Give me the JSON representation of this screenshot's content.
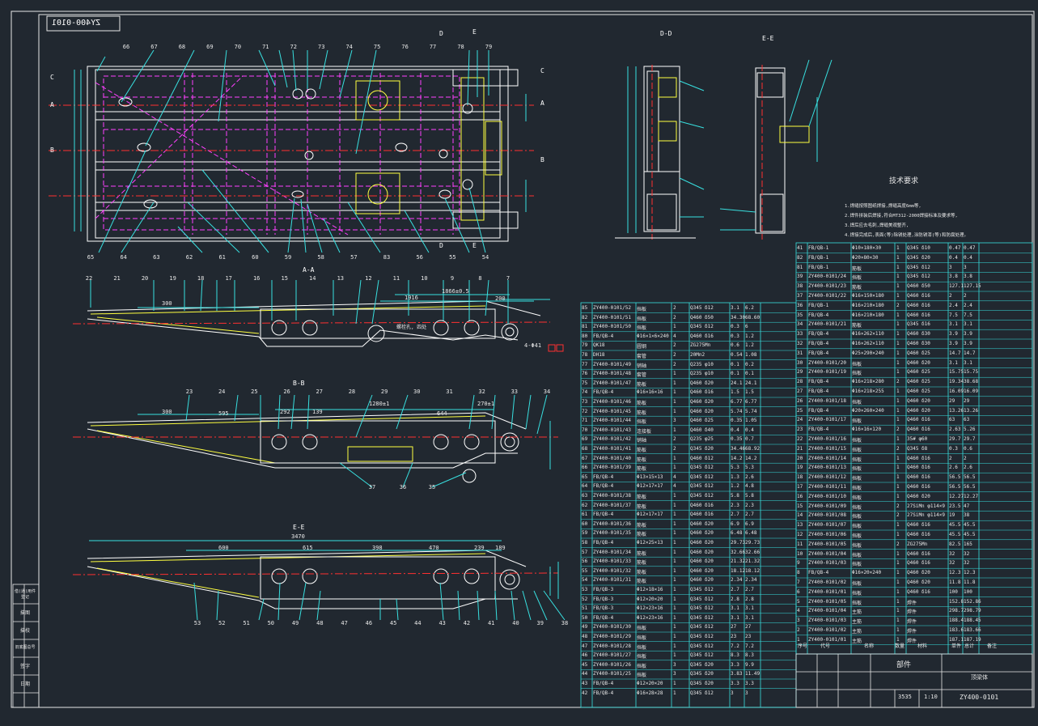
{
  "drawing": {
    "number_mirrored": "ZY400-0101",
    "title_block": {
      "part_type": "部件",
      "name": "顶梁体",
      "drawing_no": "ZY400-0101",
      "weight": "3535",
      "scale": "1:10"
    }
  },
  "views": {
    "aa": "A-A",
    "bb": "B-B",
    "ee_front": "E-E",
    "dd": "D-D",
    "ee": "E-E"
  },
  "section_markers": [
    "A",
    "B",
    "C",
    "D",
    "E"
  ],
  "plan_view": {
    "top_balloons": [
      "66",
      "67",
      "68",
      "69",
      "70",
      "71",
      "72",
      "73",
      "74",
      "75",
      "76",
      "77",
      "78",
      "79"
    ],
    "bottom_balloons": [
      "65",
      "64",
      "63",
      "62",
      "61",
      "60",
      "59",
      "58",
      "57",
      "83",
      "56",
      "55",
      "54"
    ]
  },
  "side_view_1": {
    "balloons": [
      "22",
      "21",
      "20",
      "19",
      "18",
      "17",
      "16",
      "15",
      "14",
      "13",
      "12",
      "11",
      "10",
      "9",
      "8",
      "7"
    ],
    "dims": [
      "300",
      "1916",
      "1866±0.5",
      "4-Φ41",
      "200",
      "4-Φ51"
    ],
    "note": "螺栓孔, 四处"
  },
  "side_view_2": {
    "balloons": [
      "23",
      "24",
      "25",
      "26",
      "27",
      "28",
      "29",
      "30",
      "31",
      "32",
      "33",
      "34",
      "37",
      "36",
      "35"
    ],
    "dims": [
      "300",
      "595",
      "292",
      "139",
      "1280±1",
      "644",
      "270±1",
      "240",
      "2×59",
      "R",
      "R"
    ]
  },
  "side_view_3": {
    "balloons": [
      "53",
      "52",
      "51",
      "50",
      "49",
      "48",
      "47",
      "46",
      "45",
      "44",
      "43",
      "42",
      "41",
      "40",
      "39",
      "38"
    ],
    "dims": [
      "3470",
      "600",
      "615",
      "398",
      "470",
      "239",
      "189"
    ]
  },
  "tech_requirements": {
    "title": "技术要求",
    "lines": [
      "1.焊缝按照图纸焊接,焊缝高度6mm等,",
      "2.焊件拼装后焊接,符合MT312-2000焊接标准及要求等,",
      "3.焊后应去毛刺,焊缝美观整齐,",
      "4.焊接完成后,表面(等)除锈处理,涂防锈漆(等)和防腐处理。"
    ]
  },
  "bom_left": [
    [
      "85",
      "ZY400-0101/52",
      "挡板",
      "2",
      "Q345 δ12",
      "3.1",
      "6.2"
    ],
    [
      "82",
      "ZY400-0101/51",
      "挡板",
      "2",
      "Q460 δ50",
      "34.30",
      "68.60"
    ],
    [
      "81",
      "ZY400-0101/50",
      "挡板",
      "1",
      "Q345 δ12",
      "0.3",
      "6"
    ],
    [
      "80",
      "FB/QB-4",
      "Φ16×1×6×240",
      "4",
      "Q460 δ16",
      "0.3",
      "1.2"
    ],
    [
      "79",
      "QK18",
      "圆钢",
      "2",
      "ZG275Mn",
      "0.6",
      "1.2"
    ],
    [
      "78",
      "DH18",
      "套管",
      "2",
      "20Mn2",
      "0.54",
      "1.08"
    ],
    [
      "77",
      "ZY400-0101/49",
      "销轴",
      "2",
      "Q235 φ10",
      "0.1",
      "0.2"
    ],
    [
      "76",
      "ZY400-0101/48",
      "套管",
      "1",
      "Q235 φ10",
      "0.1",
      "0.1"
    ],
    [
      "75",
      "ZY400-0101/47",
      "筋板",
      "1",
      "Q460 δ20",
      "24.1",
      "24.1"
    ],
    [
      "74",
      "FB/QB-4",
      "Φ16×16×16",
      "1",
      "Q460 δ16",
      "1.5",
      "1.5"
    ],
    [
      "73",
      "ZY400-0101/46",
      "筋板",
      "1",
      "Q460 δ20",
      "6.77",
      "6.77"
    ],
    [
      "72",
      "ZY400-0101/45",
      "筋板",
      "1",
      "Q460 δ20",
      "5.74",
      "5.74"
    ],
    [
      "71",
      "ZY400-0101/44",
      "挡板",
      "3",
      "Q460 δ25",
      "0.35",
      "1.05"
    ],
    [
      "70",
      "ZY400-0101/43",
      "连接板",
      "1",
      "Q460 δ40",
      "0.4",
      "0.4"
    ],
    [
      "69",
      "ZY400-0101/42",
      "销轴",
      "2",
      "Q235 φ25",
      "0.35",
      "0.7"
    ],
    [
      "68",
      "ZY400-0101/41",
      "筋板",
      "2",
      "Q345 δ20",
      "34.46",
      "68.92"
    ],
    [
      "67",
      "ZY400-0101/40",
      "筋板",
      "1",
      "Q460 δ12",
      "14.2",
      "14.2"
    ],
    [
      "66",
      "ZY400-0101/39",
      "筋板",
      "1",
      "Q345 δ12",
      "5.3",
      "5.3"
    ],
    [
      "65",
      "FB/QB-4",
      "Φ13×15×13",
      "4",
      "Q345 δ12",
      "1.3",
      "2.6"
    ],
    [
      "64",
      "FB/QB-4",
      "Φ12×17×17",
      "4",
      "Q345 δ12",
      "1.2",
      "4.8"
    ],
    [
      "63",
      "ZY400-0101/38",
      "筋板",
      "1",
      "Q345 δ12",
      "5.8",
      "5.8"
    ],
    [
      "62",
      "ZY400-0101/37",
      "筋板",
      "1",
      "Q460 δ16",
      "2.3",
      "2.3"
    ],
    [
      "61",
      "FB/QB-4",
      "Φ12×17×17",
      "1",
      "Q460 δ16",
      "2.7",
      "2.7"
    ],
    [
      "60",
      "ZY400-0101/36",
      "筋板",
      "1",
      "Q460 δ20",
      "6.9",
      "6.9"
    ],
    [
      "59",
      "ZY400-0101/35",
      "筋板",
      "1",
      "Q460 δ20",
      "6.48",
      "6.48"
    ],
    [
      "58",
      "FB/QB-4",
      "Φ12×25×13",
      "1",
      "Q460 δ20",
      "29.73",
      "29.73"
    ],
    [
      "57",
      "ZY400-0101/34",
      "筋板",
      "1",
      "Q460 δ20",
      "32.66",
      "32.66"
    ],
    [
      "56",
      "ZY400-0101/33",
      "筋板",
      "1",
      "Q460 δ20",
      "21.32",
      "21.32"
    ],
    [
      "55",
      "ZY400-0101/32",
      "筋板",
      "1",
      "Q460 δ20",
      "18.12",
      "18.12"
    ],
    [
      "54",
      "ZY400-0101/31",
      "筋板",
      "1",
      "Q460 δ20",
      "2.34",
      "2.34"
    ],
    [
      "53",
      "FB/QB-3",
      "Φ12×18×16",
      "1",
      "Q345 δ12",
      "2.7",
      "2.7"
    ],
    [
      "52",
      "FB/QB-3",
      "Φ12×20×20",
      "1",
      "Q345 δ12",
      "2.8",
      "2.8"
    ],
    [
      "51",
      "FB/QB-3",
      "Φ12×23×16",
      "1",
      "Q345 δ12",
      "3.1",
      "3.1"
    ],
    [
      "50",
      "FB/QB-4",
      "Φ12×23×16",
      "1",
      "Q345 δ12",
      "3.1",
      "3.1"
    ],
    [
      "49",
      "ZY400-0101/30",
      "挡板",
      "1",
      "Q345 δ12",
      "27",
      "27"
    ],
    [
      "48",
      "ZY400-0101/29",
      "挡板",
      "1",
      "Q345 δ12",
      "23",
      "23"
    ],
    [
      "47",
      "ZY400-0101/28",
      "挡板",
      "1",
      "Q345 δ12",
      "7.2",
      "7.2"
    ],
    [
      "46",
      "ZY400-0101/27",
      "挡板",
      "1",
      "Q345 δ12",
      "8.3",
      "8.3"
    ],
    [
      "45",
      "ZY400-0101/26",
      "挡板",
      "3",
      "Q345 δ20",
      "3.3",
      "9.9"
    ],
    [
      "44",
      "ZY400-0101/25",
      "挡板",
      "3",
      "Q345 δ20",
      "3.83",
      "11.49"
    ],
    [
      "43",
      "FB/QB-4",
      "Φ12×20×20",
      "1",
      "Q345 δ20",
      "3.3",
      "3.3"
    ],
    [
      "42",
      "FB/QB-4",
      "Φ16×28×28",
      "1",
      "Q345 δ12",
      "3",
      "3"
    ]
  ],
  "bom_right": [
    [
      "41",
      "FB/QB-1",
      "Φ10×180×30",
      "1",
      "Q345 δ10",
      "0.47",
      "0.47"
    ],
    [
      "82",
      "FB/QB-1",
      "Φ20×80×30",
      "1",
      "Q345 δ20",
      "0.4",
      "0.4"
    ],
    [
      "81",
      "FB/QB-1",
      "筋板",
      "1",
      "Q345 δ12",
      "3",
      "3"
    ],
    [
      "39",
      "ZY400-0101/24",
      "挡板",
      "1",
      "Q345 δ12",
      "3.8",
      "3.8"
    ],
    [
      "38",
      "ZY400-0101/23",
      "筋板",
      "1",
      "Q460 δ50",
      "127.15",
      "127.15"
    ],
    [
      "37",
      "ZY400-0101/22",
      "Φ16×150×180",
      "1",
      "Q460 δ16",
      "2",
      "2"
    ],
    [
      "36",
      "FB/QB-1",
      "Φ16×210×180",
      "2",
      "Q460 δ16",
      "2.4",
      "2.4"
    ],
    [
      "35",
      "FB/QB-4",
      "Φ16×210×180",
      "1",
      "Q460 δ16",
      "7.5",
      "7.5"
    ],
    [
      "34",
      "ZY400-0101/21",
      "筋板",
      "1",
      "Q345 δ16",
      "3.1",
      "3.1"
    ],
    [
      "33",
      "FB/QB-4",
      "Φ16×262×110",
      "1",
      "Q460 δ30",
      "3.9",
      "3.9"
    ],
    [
      "32",
      "FB/QB-4",
      "Φ16×262×110",
      "1",
      "Q460 δ30",
      "3.9",
      "3.9"
    ],
    [
      "31",
      "FB/QB-4",
      "Φ25×290×240",
      "1",
      "Q460 δ25",
      "14.7",
      "14.7"
    ],
    [
      "30",
      "ZY400-0101/20",
      "挡板",
      "1",
      "Q460 δ20",
      "3.1",
      "3.1"
    ],
    [
      "29",
      "ZY400-0101/19",
      "挡板",
      "1",
      "Q460 δ25",
      "15.75",
      "15.75"
    ],
    [
      "28",
      "FB/QB-4",
      "Φ16×218×280",
      "2",
      "Q460 δ25",
      "19.34",
      "38.68"
    ],
    [
      "27",
      "FB/QB-4",
      "Φ16×218×255",
      "1",
      "Q460 δ25",
      "16.09",
      "16.09"
    ],
    [
      "26",
      "ZY400-0101/18",
      "挡板",
      "1",
      "Q460 δ20",
      "29",
      "29"
    ],
    [
      "25",
      "FB/QB-4",
      "Φ20×260×240",
      "1",
      "Q460 δ20",
      "13.26",
      "13.26"
    ],
    [
      "24",
      "ZY400-0101/17",
      "挡板",
      "1",
      "Q460 δ16",
      "63",
      "63"
    ],
    [
      "23",
      "FB/QB-4",
      "Φ16×16×120",
      "2",
      "Q460 δ16",
      "2.63",
      "5.26"
    ],
    [
      "22",
      "ZY400-0101/16",
      "挡板",
      "1",
      "35# φ60",
      "29.7",
      "29.7"
    ],
    [
      "21",
      "ZY400-0101/15",
      "挡板",
      "2",
      "Q345 δ8",
      "0.3",
      "0.6"
    ],
    [
      "20",
      "ZY400-0101/14",
      "挡板",
      "1",
      "Q460 δ16",
      "2",
      "2"
    ],
    [
      "19",
      "ZY400-0101/13",
      "挡板",
      "1",
      "Q460 δ16",
      "2.6",
      "2.6"
    ],
    [
      "18",
      "ZY400-0101/12",
      "挡板",
      "1",
      "Q460 δ16",
      "56.5",
      "56.5"
    ],
    [
      "17",
      "ZY400-0101/11",
      "挡板",
      "1",
      "Q460 δ16",
      "56.5",
      "56.5"
    ],
    [
      "16",
      "ZY400-0101/10",
      "挡板",
      "1",
      "Q460 δ20",
      "12.27",
      "12.27"
    ],
    [
      "15",
      "ZY400-0101/09",
      "挡板",
      "2",
      "27SiMn φ114×9",
      "23.5",
      "47"
    ],
    [
      "14",
      "ZY400-0101/08",
      "挡板",
      "2",
      "27SiMn φ114×9",
      "19",
      "38"
    ],
    [
      "13",
      "ZY400-0101/07",
      "挡板",
      "1",
      "Q460 δ16",
      "45.5",
      "45.5"
    ],
    [
      "12",
      "ZY400-0101/06",
      "挡板",
      "1",
      "Q460 δ16",
      "45.5",
      "45.5"
    ],
    [
      "11",
      "ZY400-0101/05",
      "挡板",
      "2",
      "ZG275Mn",
      "82.5",
      "165"
    ],
    [
      "10",
      "ZY400-0101/04",
      "挡板",
      "1",
      "Q460 δ16",
      "32",
      "32"
    ],
    [
      "9",
      "ZY400-0101/03",
      "挡板",
      "1",
      "Q460 δ16",
      "32",
      "32"
    ],
    [
      "8",
      "FB/QB-4",
      "Φ16×20×240",
      "1",
      "Q460 δ20",
      "12.3",
      "12.3"
    ],
    [
      "7",
      "ZY400-0101/02",
      "挡板",
      "1",
      "Q460 δ20",
      "11.8",
      "11.8"
    ],
    [
      "6",
      "ZY400-0101/01",
      "挡板",
      "1",
      "Q460 δ16",
      "100",
      "100"
    ],
    [
      "5",
      "ZY400-0101/05",
      "挡板",
      "1",
      "焊件",
      "152.86",
      "152.86"
    ],
    [
      "4",
      "ZY400-0101/04",
      "主筋",
      "1",
      "焊件",
      "298.79",
      "298.79"
    ],
    [
      "3",
      "ZY400-0101/03",
      "主筋",
      "1",
      "焊件",
      "188.45",
      "188.45"
    ],
    [
      "2",
      "ZY400-0101/02",
      "主筋",
      "1",
      "焊件",
      "183.66",
      "183.66"
    ],
    [
      "1",
      "ZY400-0101/01",
      "主筋",
      "1",
      "焊件",
      "187.19",
      "187.19"
    ]
  ],
  "bom_header": [
    "序号",
    "代号",
    "名称",
    "数量",
    "材料",
    "单件",
    "总计",
    "备注"
  ],
  "left_strip": [
    "借(通)用件登记",
    "描图",
    "描校",
    "旧底图总号",
    "签字",
    "日期"
  ],
  "colors": {
    "background": "#212830",
    "cyan": "#38e0e0",
    "magenta": "#ff40ff",
    "yellow": "#ffff40",
    "white": "#ffffff",
    "red": "#ff3030",
    "green": "#30ff60"
  }
}
